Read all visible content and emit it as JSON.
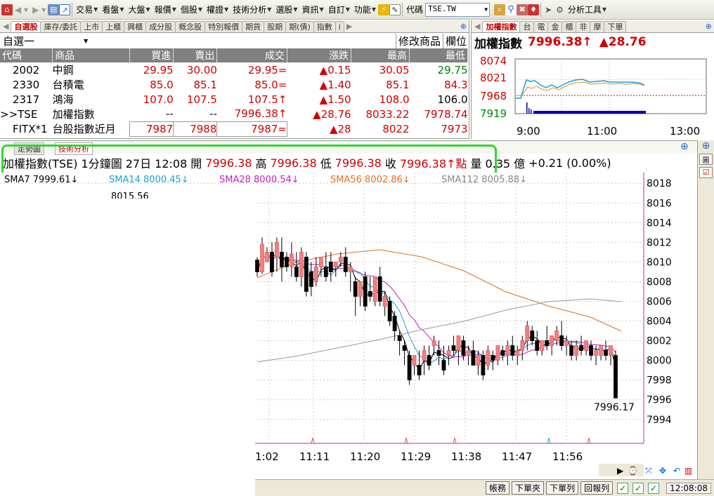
{
  "toolbar": {
    "items": [
      "交易",
      "看盤",
      "大盤",
      "報價",
      "個股",
      "權證",
      "技術分析",
      "選股",
      "資訊",
      "自訂",
      "功能"
    ],
    "code_label": "代碼",
    "code_value": "TSE.TW",
    "analysis_tools": "分析工具"
  },
  "watchlist": {
    "tabs": [
      "自選股",
      "庫存/委託",
      "上市",
      "上櫃",
      "興櫃",
      "成分股",
      "概念股",
      "特別報價",
      "期貨",
      "股期",
      "期(債)",
      "指數",
      "i"
    ],
    "list_name": "自選一",
    "modify": "修改商品",
    "columns_btn": "欄位",
    "headers": [
      "代碼",
      "商品",
      "買進",
      "賣出",
      "成交",
      "漲跌",
      "最高",
      "最低"
    ],
    "rows": [
      {
        "code": "2002",
        "name": "中鋼",
        "bid": "29.95",
        "ask": "30.00",
        "last": "29.95=",
        "chg": "▲0.15",
        "high": "30.05",
        "low": "29.75"
      },
      {
        "code": "2330",
        "name": "台積電",
        "bid": "85.0",
        "ask": "85.1",
        "last": "85.0=",
        "chg": "▲1.40",
        "high": "85.1",
        "low": "84.3"
      },
      {
        "code": "2317",
        "name": "鴻海",
        "bid": "107.0",
        "ask": "107.5",
        "last": "107.5↑",
        "chg": "▲1.50",
        "high": "108.0",
        "low": "106.0"
      },
      {
        "code": ">>TSE",
        "name": "加權指數",
        "bid": "--",
        "ask": "--",
        "last": "7996.38↑",
        "chg": "▲28.76",
        "high": "8033.22",
        "low": "7978.74"
      },
      {
        "code": "FITX*1",
        "name": "台股指數近月",
        "bid": "7987",
        "ask": "7988",
        "last": "7987=",
        "chg": "▲28",
        "high": "8022",
        "low": "7973"
      }
    ]
  },
  "mini": {
    "tabs": [
      "加權指數",
      "台",
      "電",
      "金",
      "櫃",
      "非",
      "摩",
      "下單"
    ],
    "title": "加權指數",
    "price": "7996.38↑",
    "change": "▲28.76",
    "y_ticks": [
      "8074",
      "8021",
      "7968",
      "7919"
    ],
    "x_ticks": [
      "9:00",
      "11:00",
      "13:00"
    ]
  },
  "main": {
    "tabs": [
      "走勢圖",
      "技術分析"
    ],
    "info": {
      "name": "加權指數(TSE)",
      "period": "1分鐘圖",
      "date": "27日 12:08",
      "open_label": "開",
      "open": "7996.38",
      "high_label": "高",
      "high": "7996.38",
      "low_label": "低",
      "low": "7996.38",
      "close_label": "收",
      "close": "7996.38↑點",
      "vol_label": "量",
      "vol": "0.35 億",
      "change": "+0.21 (0.00%)"
    },
    "ma_legend": [
      "SMA7 7999.61↓",
      "SMA14 8000.45↓",
      "SMA28 8000.54↓",
      "SMA56 8002.86↓",
      "SMA112 8005.88↓"
    ],
    "peak_label": "8015.56",
    "last_label": "7996.17"
  },
  "chart_data": {
    "type": "candlestick",
    "title": "加權指數(TSE) 1分鐘圖",
    "y_ticks": [
      8018,
      8016,
      8014,
      8012,
      8010,
      8008,
      8006,
      8004,
      8002,
      8000,
      7998,
      7996,
      7994
    ],
    "ylim": [
      7992.2,
      8018.8
    ],
    "x_ticks": [
      "1:02",
      "11:11",
      "11:20",
      "11:29",
      "11:38",
      "11:47",
      "11:56"
    ],
    "ohlc": [
      [
        8010.2,
        8010.5,
        8008.5,
        8009.0
      ],
      [
        8009.0,
        8012.5,
        8008.8,
        8011.8
      ],
      [
        8010.0,
        8011.5,
        8010.5,
        8011.0
      ],
      [
        8011.0,
        8012.0,
        8008.5,
        8009.0
      ],
      [
        8010.5,
        8012.5,
        8009.0,
        8012.0
      ],
      [
        8011.0,
        8012.5,
        8008.0,
        8009.5
      ],
      [
        8010.5,
        8011.0,
        8009.0,
        8009.5
      ],
      [
        8009.5,
        8012.0,
        8008.5,
        8010.8
      ],
      [
        8009.5,
        8011.0,
        8008.0,
        8008.5
      ],
      [
        8008.5,
        8011.5,
        8007.5,
        8011.0
      ],
      [
        8010.5,
        8011.0,
        8006.5,
        8007.0
      ],
      [
        8009.0,
        8010.0,
        8006.5,
        8007.5
      ],
      [
        8008.0,
        8010.5,
        8007.5,
        8009.5
      ],
      [
        8009.5,
        8010.5,
        8008.5,
        8010.5
      ],
      [
        8009.5,
        8011.0,
        8008.0,
        8008.5
      ],
      [
        8010.0,
        8011.0,
        8008.0,
        8009.0
      ],
      [
        8009.5,
        8010.0,
        8008.5,
        8010.0
      ],
      [
        8010.0,
        8011.0,
        8009.5,
        8010.5
      ],
      [
        8010.5,
        8011.5,
        8008.5,
        8009.0
      ],
      [
        8009.0,
        8010.0,
        8007.0,
        8009.5
      ],
      [
        8008.0,
        8008.5,
        8004.5,
        8006.5
      ],
      [
        8006.5,
        8008.0,
        8005.5,
        8008.0
      ],
      [
        8008.5,
        8009.0,
        8005.0,
        8005.5
      ],
      [
        8007.0,
        8008.5,
        8006.0,
        8006.5
      ],
      [
        8006.0,
        8008.5,
        8005.5,
        8008.5
      ],
      [
        8008.5,
        8009.5,
        8005.5,
        8006.0
      ],
      [
        8005.5,
        8007.0,
        8004.5,
        8006.5
      ],
      [
        8006.0,
        8006.5,
        8003.5,
        8004.0
      ],
      [
        8004.5,
        8005.0,
        8002.0,
        8003.0
      ],
      [
        8002.5,
        8003.0,
        8000.5,
        8002.0
      ],
      [
        8001.5,
        8002.0,
        7999.5,
        8001.0
      ],
      [
        8000.5,
        8001.0,
        7997.5,
        7998.0
      ],
      [
        7999.5,
        8000.5,
        7998.5,
        8000.5
      ],
      [
        7999.5,
        8001.0,
        7998.0,
        7998.5
      ],
      [
        8000.0,
        8001.5,
        7998.5,
        8001.0
      ],
      [
        8000.5,
        8001.5,
        7999.0,
        7999.5
      ],
      [
        8001.5,
        8002.5,
        8000.5,
        8002.0
      ],
      [
        8001.0,
        8002.0,
        7999.5,
        8000.5
      ],
      [
        8000.0,
        8001.5,
        7998.5,
        7999.0
      ],
      [
        8000.5,
        8001.5,
        7999.5,
        8001.0
      ],
      [
        8001.5,
        8002.5,
        8000.5,
        8001.0
      ],
      [
        8001.0,
        8002.5,
        7999.5,
        8002.5
      ],
      [
        8002.0,
        8002.5,
        8000.0,
        8000.5
      ],
      [
        8000.5,
        8001.5,
        7999.5,
        8001.0
      ],
      [
        8001.0,
        8002.0,
        7999.5,
        7999.5
      ],
      [
        7999.5,
        8001.0,
        7998.5,
        8000.5
      ],
      [
        8000.5,
        8001.0,
        7998.0,
        7998.5
      ],
      [
        7999.5,
        8001.5,
        7999.0,
        8001.0
      ],
      [
        8000.5,
        8001.0,
        7999.0,
        8000.0
      ],
      [
        8000.0,
        8001.5,
        7999.5,
        8001.5
      ],
      [
        8001.0,
        8001.5,
        8000.0,
        8000.5
      ],
      [
        8000.5,
        8002.0,
        7999.5,
        8001.5
      ],
      [
        8001.5,
        8002.5,
        8000.0,
        8000.5
      ],
      [
        8000.5,
        8001.5,
        7999.5,
        8001.0
      ],
      [
        8001.0,
        8002.5,
        8000.0,
        8002.0
      ],
      [
        8002.0,
        8004.0,
        8001.0,
        8003.5
      ],
      [
        8003.0,
        8003.5,
        8001.5,
        8002.0
      ],
      [
        8002.0,
        8003.0,
        8000.5,
        8001.0
      ],
      [
        8001.0,
        8002.0,
        8000.5,
        8002.0
      ],
      [
        8002.0,
        8003.5,
        8001.0,
        8001.5
      ],
      [
        8001.5,
        8002.5,
        8000.5,
        8002.5
      ],
      [
        8002.0,
        8003.5,
        8001.5,
        8003.0
      ],
      [
        8002.5,
        8004.0,
        8001.0,
        8001.5
      ],
      [
        8001.5,
        8002.5,
        8000.5,
        8002.0
      ],
      [
        8001.5,
        8002.0,
        8000.0,
        8000.5
      ],
      [
        8000.5,
        8002.0,
        8000.0,
        8001.5
      ],
      [
        8001.5,
        8002.5,
        8000.5,
        8001.0
      ],
      [
        8001.0,
        8002.0,
        8000.5,
        8002.0
      ],
      [
        8001.5,
        8002.0,
        8000.0,
        8000.5
      ],
      [
        8000.5,
        8001.5,
        7999.5,
        8001.0
      ],
      [
        8000.5,
        8001.5,
        8000.0,
        8001.5
      ],
      [
        8001.0,
        8002.0,
        8000.0,
        8000.5
      ],
      [
        8000.5,
        8001.5,
        7999.5,
        8001.5
      ],
      [
        8000.5,
        8001.0,
        7996.17,
        7996.17
      ]
    ],
    "colors": {
      "up": "#e06060",
      "down": "#000000"
    }
  },
  "status": {
    "buttons": [
      "帳務",
      "下單夾",
      "下單列",
      "回報列"
    ],
    "time": "12:08:08"
  }
}
